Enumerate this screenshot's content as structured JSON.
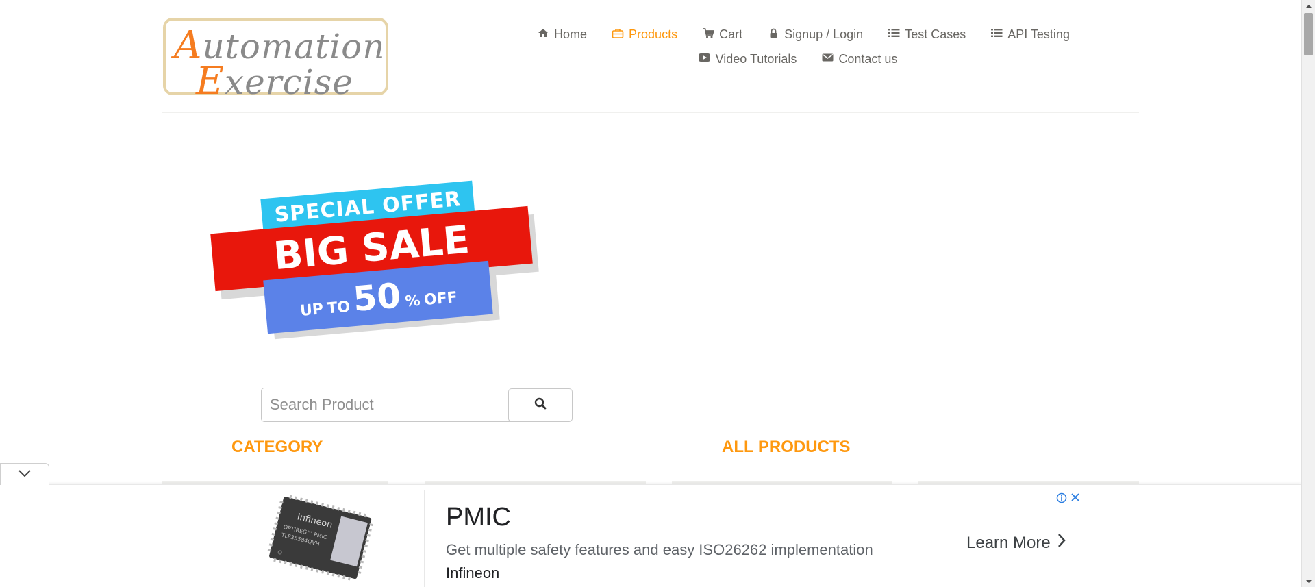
{
  "logo": {
    "line1": "utomation",
    "line1_cap": "A",
    "line2": "xercise",
    "line2_cap": "E"
  },
  "nav": {
    "row1": [
      {
        "label": "Home",
        "icon": "home-icon",
        "active": false
      },
      {
        "label": "Products",
        "icon": "briefcase-icon",
        "active": true
      },
      {
        "label": "Cart",
        "icon": "cart-icon",
        "active": false
      },
      {
        "label": "Signup / Login",
        "icon": "lock-icon",
        "active": false
      },
      {
        "label": "Test Cases",
        "icon": "list-icon",
        "active": false
      },
      {
        "label": "API Testing",
        "icon": "list-icon",
        "active": false
      }
    ],
    "row2": [
      {
        "label": "Video Tutorials",
        "icon": "youtube-play-icon",
        "active": false
      },
      {
        "label": "Contact us",
        "icon": "envelope-icon",
        "active": false
      }
    ]
  },
  "banner": {
    "top": "SPECIAL OFFER",
    "middle": "BIG SALE",
    "bottom_small1": "UP",
    "bottom_small2": "TO",
    "bottom_big": "50",
    "bottom_pct": "%",
    "bottom_off": "OFF"
  },
  "search": {
    "placeholder": "Search Product",
    "value": ""
  },
  "sections": {
    "category": "CATEGORY",
    "all_products": "ALL PRODUCTS"
  },
  "ad": {
    "title": "PMIC",
    "description": "Get multiple safety features and easy ISO26262 implementation",
    "brand": "Infineon",
    "cta": "Learn More",
    "chip_brand": "Infineon",
    "chip_text1": "OPTIREG™ PMIC",
    "chip_text2": "TLF35584QVH"
  },
  "colors": {
    "accent": "#fe980f",
    "nav_text": "#696763",
    "banner_blue": "#2ec4f0",
    "banner_red": "#e8170c",
    "banner_periwinkle": "#5b82e8"
  }
}
